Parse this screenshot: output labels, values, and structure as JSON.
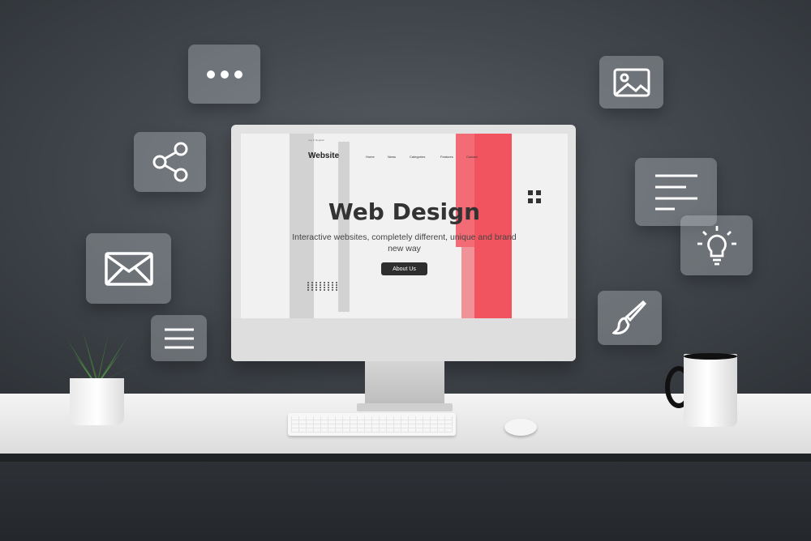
{
  "scene": {
    "screen": {
      "logo": "Website",
      "topbar_left": "Log in  Register",
      "nav": [
        "Home",
        "News",
        "Categories",
        "Features",
        "Contact"
      ],
      "headline": "Web Design",
      "subtitle": "Interactive websites, completely different, unique and brand new way",
      "button_label": "About Us"
    },
    "floating_icons": [
      "more-dots-icon",
      "share-icon",
      "mail-icon",
      "menu-icon",
      "image-icon",
      "text-lines-icon",
      "lightbulb-icon",
      "paintbrush-icon"
    ],
    "colors": {
      "accent_red": "#f2545f",
      "wall": "#44494f",
      "tile": "#b9bec3"
    }
  }
}
